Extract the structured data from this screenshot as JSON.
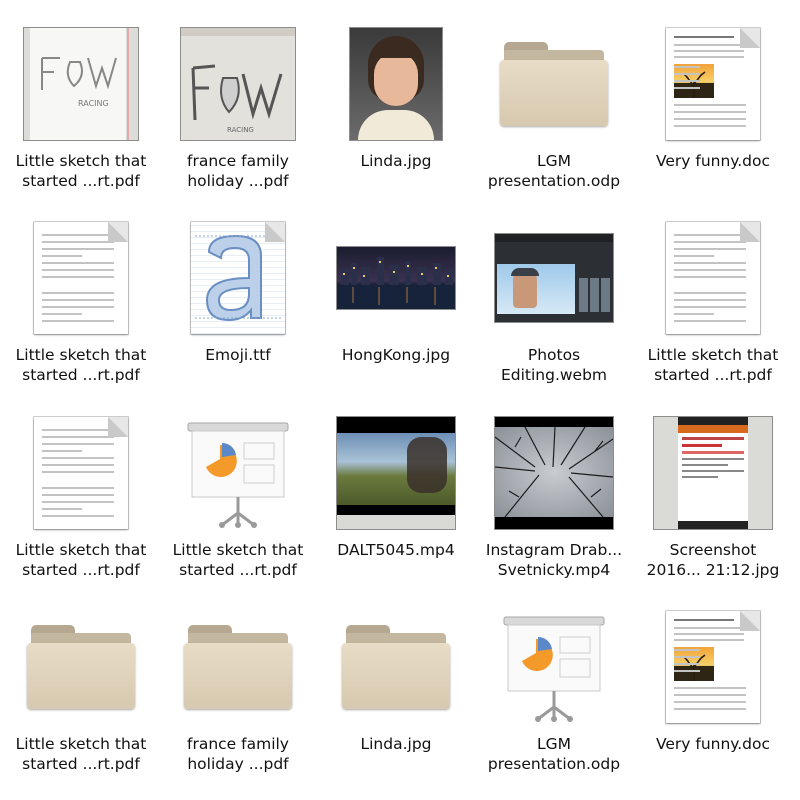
{
  "files": [
    {
      "label": "Little sketch that\nstarted ...rt.pdf",
      "kind": "sketch1",
      "icon": "pdf-thumbnail-icon"
    },
    {
      "label": "france family\nholiday ...pdf",
      "kind": "sketch2",
      "icon": "pdf-thumbnail-icon"
    },
    {
      "label": "Linda.jpg",
      "kind": "portrait",
      "icon": "image-thumbnail-icon"
    },
    {
      "label": "LGM\npresentation.odp",
      "kind": "folder",
      "icon": "folder-icon"
    },
    {
      "label": "Very funny.doc",
      "kind": "docsunset",
      "icon": "document-icon"
    },
    {
      "label": "Little sketch that\nstarted ...rt.pdf",
      "kind": "doctext",
      "icon": "document-icon"
    },
    {
      "label": "Emoji.ttf",
      "kind": "font",
      "icon": "font-icon"
    },
    {
      "label": "HongKong.jpg",
      "kind": "cityscape",
      "icon": "image-thumbnail-icon"
    },
    {
      "label": "Photos\nEditing.webm",
      "kind": "videoui",
      "icon": "video-thumbnail-icon"
    },
    {
      "label": "Little sketch that\nstarted ...rt.pdf",
      "kind": "doctext",
      "icon": "document-icon"
    },
    {
      "label": "Little sketch that\nstarted ...rt.pdf",
      "kind": "doctext",
      "icon": "document-icon"
    },
    {
      "label": "Little sketch that\nstarted ...rt.pdf",
      "kind": "presentation",
      "icon": "presentation-icon"
    },
    {
      "label": "DALT5045.mp4",
      "kind": "video1",
      "icon": "video-thumbnail-icon"
    },
    {
      "label": "Instagram Drab...\nSvetnicky.mp4",
      "kind": "trees",
      "icon": "video-thumbnail-icon"
    },
    {
      "label": "Screenshot\n2016... 21:12.jpg",
      "kind": "screenshot",
      "icon": "image-thumbnail-icon"
    },
    {
      "label": "Little sketch that\nstarted ...rt.pdf",
      "kind": "folder",
      "icon": "folder-icon"
    },
    {
      "label": "france family\nholiday ...pdf",
      "kind": "folder",
      "icon": "folder-icon"
    },
    {
      "label": "Linda.jpg",
      "kind": "folder",
      "icon": "folder-icon"
    },
    {
      "label": "LGM\npresentation.odp",
      "kind": "presentation",
      "icon": "presentation-icon"
    },
    {
      "label": "Very funny.doc",
      "kind": "docsunset",
      "icon": "document-icon"
    }
  ]
}
